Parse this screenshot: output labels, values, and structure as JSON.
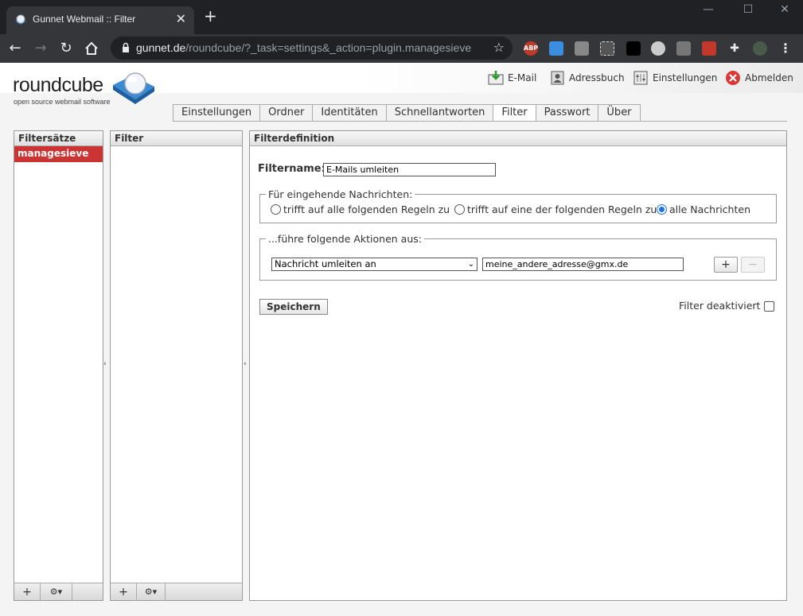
{
  "browser": {
    "tab_title": "Gunnet Webmail :: Filter",
    "url_domain": "gunnet.de",
    "url_path": "/roundcube/?_task=settings&_action=plugin.managesieve",
    "extensions": [
      "ABP"
    ]
  },
  "logo": {
    "name": "roundcube",
    "tagline": "open source webmail software"
  },
  "topnav": {
    "mail": "E-Mail",
    "addressbook": "Adressbuch",
    "settings": "Einstellungen",
    "logout": "Abmelden"
  },
  "settings_tabs": [
    "Einstellungen",
    "Ordner",
    "Identitäten",
    "Schnellantworten",
    "Filter",
    "Passwort",
    "Über"
  ],
  "active_tab": "Filter",
  "filtersets": {
    "header": "Filtersätze",
    "items": [
      "managesieve"
    ]
  },
  "filters": {
    "header": "Filter"
  },
  "definition": {
    "header": "Filterdefinition",
    "name_label": "Filtername:",
    "name_value": "E-Mails umleiten",
    "incoming_legend": "Für eingehende Nachrichten:",
    "radio_all_rules": "trifft auf alle folgenden Regeln zu",
    "radio_any_rule": "trifft auf eine der folgenden Regeln zu",
    "radio_all_messages": "alle Nachrichten",
    "selected_radio": "alle Nachrichten",
    "actions_legend": "...führe folgende Aktionen aus:",
    "action_select": "Nachricht umleiten an",
    "action_target": "meine_andere_adresse@gmx.de",
    "save_label": "Speichern",
    "disabled_label": "Filter deaktiviert"
  }
}
